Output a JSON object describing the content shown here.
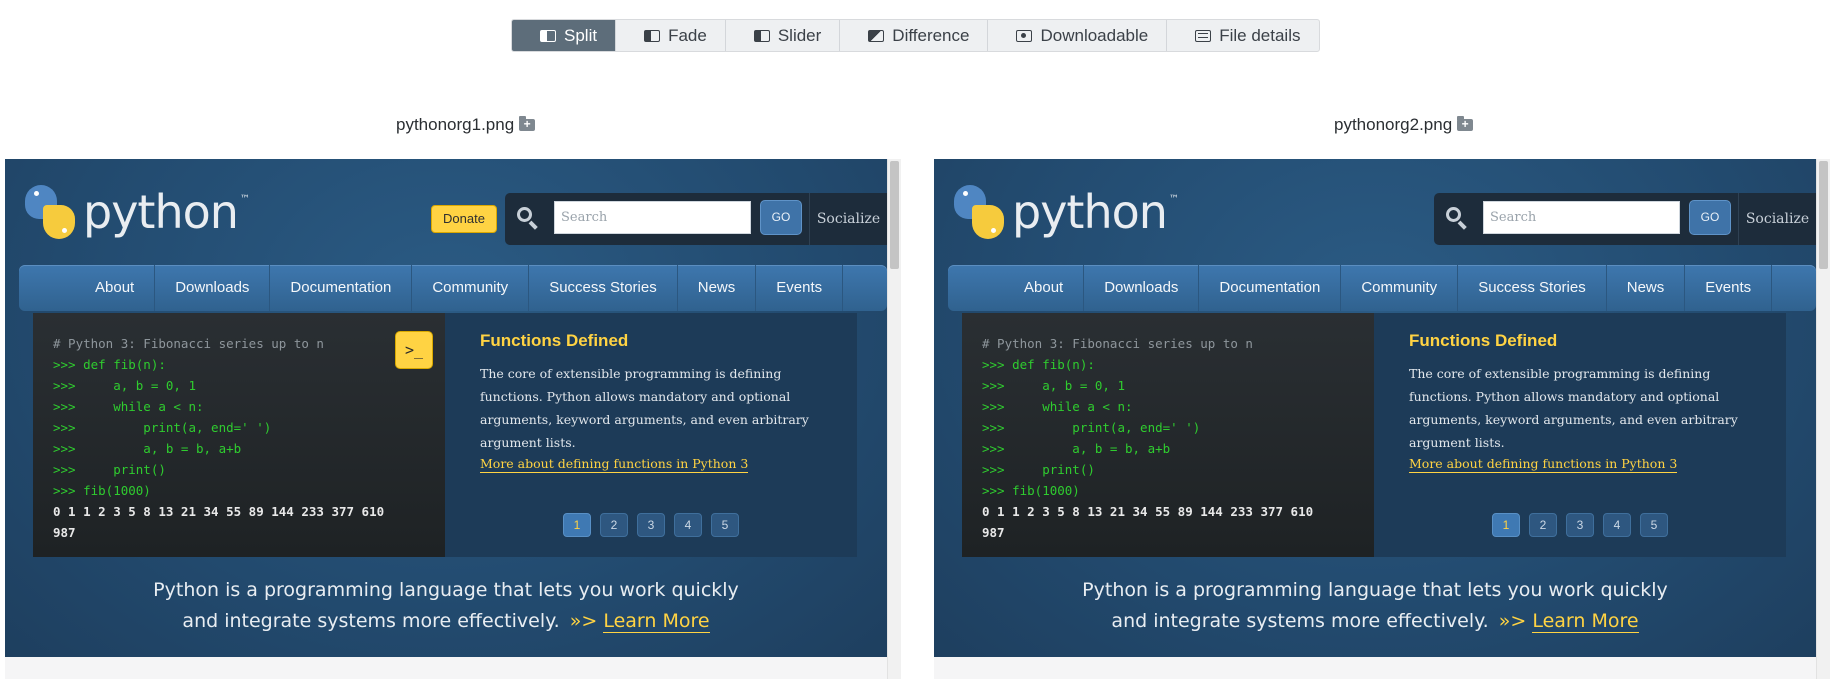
{
  "toolbar": {
    "modes": [
      {
        "label": "Split",
        "icon": "split-view-icon",
        "active": true
      },
      {
        "label": "Fade",
        "icon": "fade-icon",
        "active": false
      },
      {
        "label": "Slider",
        "icon": "slider-icon",
        "active": false
      },
      {
        "label": "Difference",
        "icon": "difference-icon",
        "active": false
      },
      {
        "label": "Downloadable",
        "icon": "downloadable-icon",
        "active": false
      },
      {
        "label": "File details",
        "icon": "file-details-icon",
        "active": false
      }
    ]
  },
  "colors": {
    "active_mode_bg": "#5d6d7a",
    "python_yellow": "#ffd343",
    "python_blue": "#2b5b84"
  },
  "files": [
    {
      "name": "pythonorg1.png",
      "icon": "add-folder-icon"
    },
    {
      "name": "pythonorg2.png",
      "icon": "add-folder-icon"
    }
  ],
  "site": {
    "logo_text": "python",
    "logo_tm": "™",
    "donate": "Donate",
    "search_placeholder": "Search",
    "go": "GO",
    "socialize": "Socialize",
    "nav": [
      "About",
      "Downloads",
      "Documentation",
      "Community",
      "Success Stories",
      "News",
      "Events"
    ],
    "code_lines": [
      "# Python 3: Fibonacci series up to n",
      ">>> def fib(n):",
      ">>>     a, b = 0, 1",
      ">>>     while a < n:",
      ">>>         print(a, end=' ')",
      ">>>         a, b = b, a+b",
      ">>>     print()",
      ">>> fib(1000)",
      "0 1 1 2 3 5 8 13 21 34 55 89 144 233 377 610",
      "987"
    ],
    "run_button": ">_",
    "feature_title": "Functions Defined",
    "feature_body": "The core of extensible programming is defining functions. Python allows mandatory and optional arguments, keyword arguments, and even arbitrary argument lists.",
    "feature_link": "More about defining functions in Python 3",
    "pages": [
      "1",
      "2",
      "3",
      "4",
      "5"
    ],
    "intro_line1": "Python is a programming language that lets you work quickly",
    "intro_line2": "and integrate systems more effectively.",
    "intro_chevrons": "»>",
    "learn_more": "Learn More"
  }
}
